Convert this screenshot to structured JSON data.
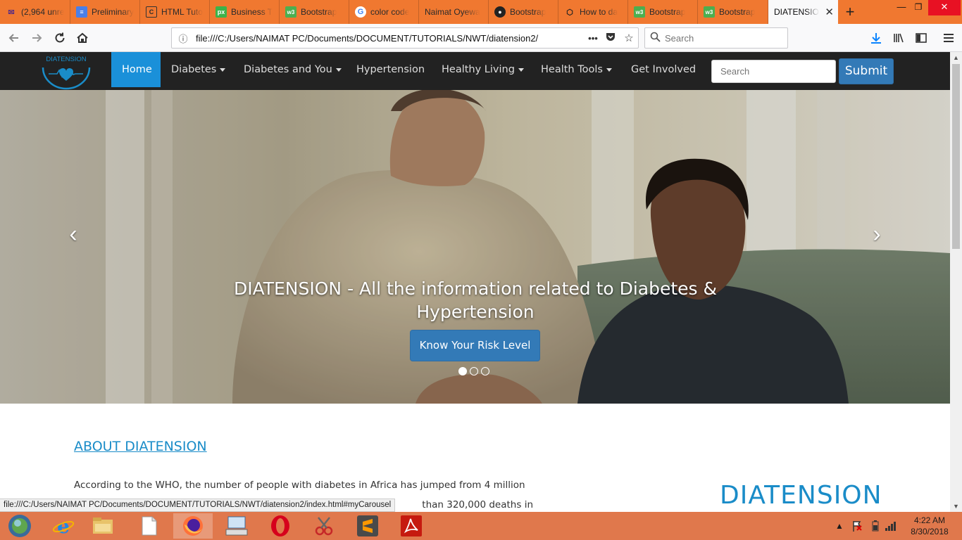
{
  "browser": {
    "tabs": [
      {
        "title": "(2,964 unre",
        "icon": "mail-icon"
      },
      {
        "title": "Preliminary",
        "icon": "doc-icon"
      },
      {
        "title": "HTML Tuto",
        "icon": "page-icon"
      },
      {
        "title": "Business T",
        "icon": "px-icon"
      },
      {
        "title": "Bootstrap",
        "icon": "w3-icon"
      },
      {
        "title": "color code",
        "icon": "google-icon"
      },
      {
        "title": "Naimat Oyewa",
        "icon": "blank-icon"
      },
      {
        "title": "Bootstrap",
        "icon": "github-icon"
      },
      {
        "title": "How to da",
        "icon": "codepen-icon"
      },
      {
        "title": "Bootstrap",
        "icon": "w3-icon"
      },
      {
        "title": "Bootstrap",
        "icon": "w3-icon"
      },
      {
        "title": "DIATENSIO",
        "icon": "blank-icon",
        "active": true
      }
    ],
    "url": "file:///C:/Users/NAIMAT PC/Documents/DOCUMENT/TUTORIALS/NWT/diatension2/",
    "search_placeholder": "Search",
    "status_url": "file:///C:/Users/NAIMAT PC/Documents/DOCUMENT/TUTORIALS/NWT/diatension2/index.html#myCarousel"
  },
  "site": {
    "logo_text": "DIATENSION",
    "nav": [
      {
        "label": "Home",
        "dropdown": false,
        "active": true
      },
      {
        "label": "Diabetes",
        "dropdown": true
      },
      {
        "label": "Diabetes and You",
        "dropdown": true
      },
      {
        "label": "Hypertension",
        "dropdown": false
      },
      {
        "label": "Healthy Living",
        "dropdown": true
      },
      {
        "label": "Health Tools",
        "dropdown": true
      },
      {
        "label": "Get Involved",
        "dropdown": false
      }
    ],
    "search_placeholder": "Search",
    "submit_label": "Submit",
    "carousel": {
      "caption_line1": "DIATENSION - All the information related to Diabetes &",
      "caption_line2": "Hypertension",
      "cta_label": "Know Your Risk Level",
      "prev_symbol": "‹",
      "next_symbol": "›",
      "slide_count": 3,
      "active_slide": 1
    },
    "about": {
      "title": "ABOUT DIATENSION",
      "line1": "According to the WHO, the number of people with diabetes in Africa has jumped from 4 million",
      "line2_visible": "than 320,000 deaths in"
    },
    "brand_heading": "DIATENSION"
  },
  "taskbar": {
    "apps": [
      "start-orb-icon",
      "internet-explorer-icon",
      "file-explorer-icon",
      "notepad-icon",
      "firefox-icon",
      "on-screen-keyboard-icon",
      "opera-icon",
      "snipping-tool-icon",
      "sublime-text-icon",
      "acrobat-icon"
    ],
    "time": "4:22 AM",
    "date": "8/30/2018"
  },
  "colors": {
    "tab_strip": "#f07830",
    "navbar": "#222222",
    "nav_active": "#1a90d9",
    "button_primary": "#337ab7",
    "accent_blue": "#1a8cc8",
    "taskbar": "#e0784c"
  }
}
